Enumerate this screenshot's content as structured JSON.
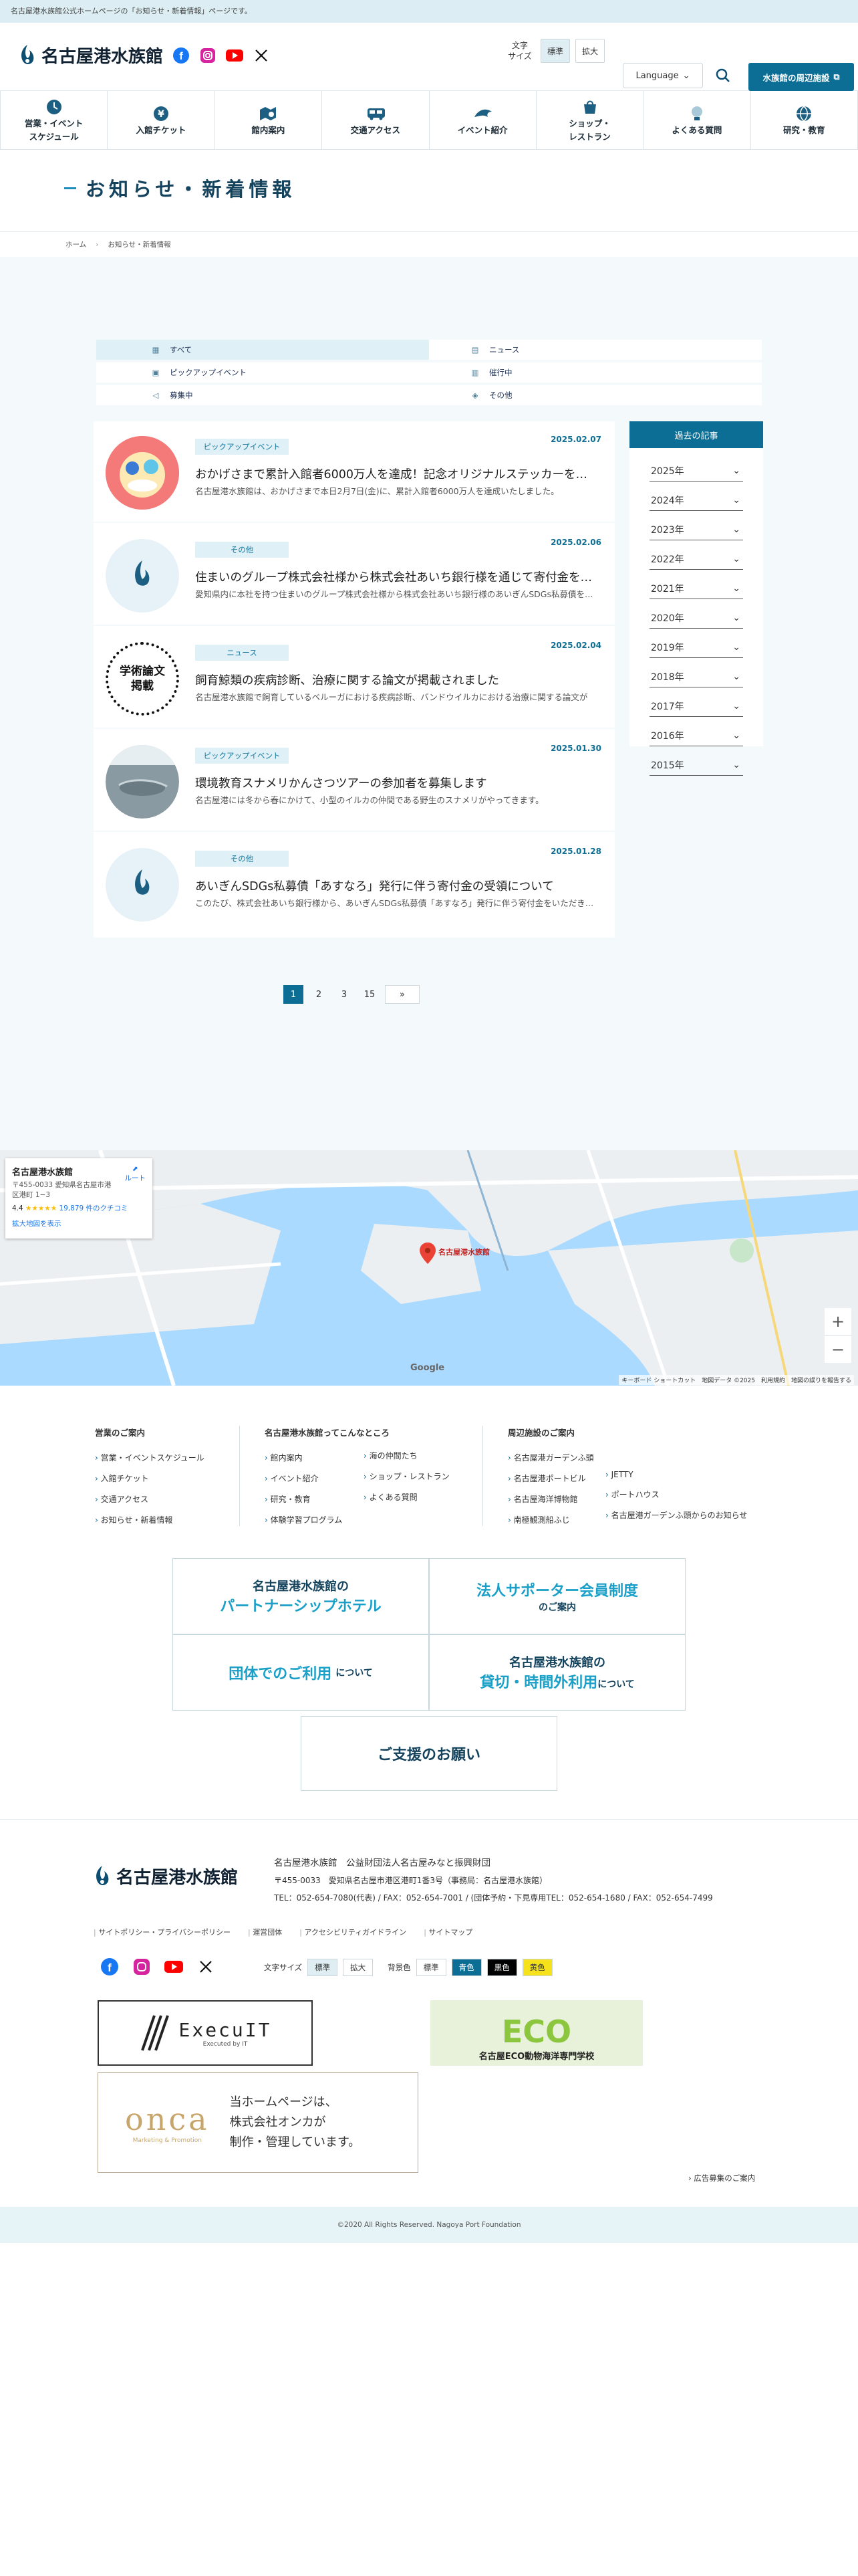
{
  "topstrip": "名古屋港水族館公式ホームページの「お知らせ・新着情報」ページです。",
  "header": {
    "logo_text": "名古屋港水族館",
    "font_size_label_1": "文字",
    "font_size_label_2": "サイズ",
    "font_standard": "標準",
    "font_large": "拡大",
    "language": "Language",
    "nearby": "水族館の周辺施設",
    "sns": [
      "facebook-icon",
      "instagram-icon",
      "youtube-icon",
      "x-icon"
    ]
  },
  "nav": [
    {
      "l1": "営業・イベント",
      "l2": "スケジュール",
      "icon": "clock-icon"
    },
    {
      "l1": "入館チケット",
      "l2": "",
      "icon": "yen-icon"
    },
    {
      "l1": "館内案内",
      "l2": "",
      "icon": "map-search-icon"
    },
    {
      "l1": "交通アクセス",
      "l2": "",
      "icon": "bus-icon"
    },
    {
      "l1": "イベント紹介",
      "l2": "",
      "icon": "dolphin-icon"
    },
    {
      "l1": "ショップ・",
      "l2": "レストラン",
      "icon": "shop-icon"
    },
    {
      "l1": "よくある質問",
      "l2": "",
      "icon": "lightbulb-icon"
    },
    {
      "l1": "研究・教育",
      "l2": "",
      "icon": "globe-icon"
    }
  ],
  "page": {
    "title": "お知らせ・新着情報"
  },
  "breadcrumb": {
    "home": "ホーム",
    "current": "お知らせ・新着情報"
  },
  "filters": {
    "all": "すべて",
    "news": "ニュース",
    "pickup": "ピックアップイベント",
    "events": "催行中",
    "recruit": "募集中",
    "other": "その他"
  },
  "posts": [
    {
      "date": "2025.02.07",
      "category": "ピックアップイベント",
      "title": "おかげさまで累計入館者6000万人を達成！記念オリジナルステッカーをプレゼント",
      "excerpt": "名古屋港水族館は、おかげさまで本日2月7日(金)に、累計入館者6000万人を達成いたしました。"
    },
    {
      "date": "2025.02.06",
      "category": "その他",
      "title": "住まいのグループ株式会社様から株式会社あいち銀行様を通じて寄付金をいただきました",
      "excerpt": "愛知県内に本社を持つ住まいのグループ株式会社様から株式会社あいち銀行様のあいぎんSDGs私募債を通じて"
    },
    {
      "date": "2025.02.04",
      "category": "ニュース",
      "title": "飼育鯨類の疾病診断、治療に関する論文が掲載されました",
      "excerpt": "名古屋港水族館で飼育しているベルーガにおける疾病診断、バンドウイルカにおける治療に関する論文が"
    },
    {
      "date": "2025.01.30",
      "category": "ピックアップイベント",
      "title": "環境教育スナメリかんさつツアーの参加者を募集します",
      "excerpt": "名古屋港には冬から春にかけて、小型のイルカの仲間である野生のスナメリがやってきます。"
    },
    {
      "date": "2025.01.28",
      "category": "その他",
      "title": "あいぎんSDGs私募債「あすなろ」発行に伴う寄付金の受領について",
      "excerpt": "このたび、株式会社あいち銀行様から、あいぎんSDGs私募債「あすなろ」発行に伴う寄付金をいただきました"
    }
  ],
  "thumb_text": {
    "paper_1": "学術論文",
    "paper_2": "掲載"
  },
  "archive": {
    "title": "過去の記事",
    "years": [
      "2025年",
      "2024年",
      "2023年",
      "2022年",
      "2021年",
      "2020年",
      "2019年",
      "2018年",
      "2017年",
      "2016年",
      "2015年"
    ]
  },
  "pagination": {
    "pages": [
      "1",
      "2",
      "3",
      "15"
    ],
    "current": "1",
    "next": "»"
  },
  "map": {
    "name": "名古屋港水族館",
    "address": "〒455-0033 愛知県名古屋市港区港町 1−3",
    "rating": "4.4",
    "stars": "★★★★★",
    "reviews": "19,879 件のクチコミ",
    "route": "ルート",
    "enlarge": "拡大地図を表示",
    "pin_label": "名古屋港水族館",
    "credit": "キーボード ショートカット　地図データ ©2025　利用規約　地図の誤りを報告する",
    "google": "Google"
  },
  "footer_links": {
    "col1_title": "営業のご案内",
    "col1": [
      "営業・イベントスケジュール",
      "入館チケット",
      "交通アクセス",
      "お知らせ・新着情報"
    ],
    "col2_title": "名古屋港水族館ってこんなところ",
    "col2a": [
      "館内案内",
      "イベント紹介",
      "研究・教育",
      "体験学習プログラム"
    ],
    "col2b": [
      "海の仲間たち",
      "ショップ・レストラン",
      "よくある質問"
    ],
    "col3_title": "周辺施設のご案内",
    "col3a": [
      "名古屋港ガーデンふ頭",
      "名古屋港ポートビル",
      "名古屋海洋博物館",
      "南極観測船ふじ"
    ],
    "col3b": [
      "JETTY",
      "ポートハウス",
      "名古屋港ガーデンふ頭からのお知らせ"
    ]
  },
  "banners": {
    "b1_a": "名古屋港水族館の",
    "b1_b": "パートナーシップホテル",
    "b2_b": "法人サポーター会員制度",
    "b2_c": "のご案内",
    "b3_b": "団体でのご利用",
    "b3_c": "について",
    "b4_a": "名古屋港水族館の",
    "b4_b": "貸切・時間外利用",
    "b4_c": "について",
    "b5": "ご支援のお願い"
  },
  "org": {
    "name": "名古屋港水族館　公益財団法人名古屋みなと振興財団",
    "address": "〒455-0033　愛知県名古屋市港区港町1番3号（事務局：名古屋港水族館）",
    "tel": "TEL：052-654-7080(代表) / FAX：052-654-7001 / (団体予約・下見専用TEL：052-654-1680 / FAX：052-654-7499",
    "links": [
      "サイトポリシー・プライバシーポリシー",
      "運営団体",
      "アクセシビリティガイドライン",
      "サイトマップ"
    ],
    "font_size": "文字サイズ",
    "standard": "標準",
    "large": "拡大",
    "bg_color": "背景色",
    "bg_std": "標準",
    "bg_blue": "青色",
    "bg_black": "黒色",
    "bg_yellow": "黄色"
  },
  "sponsors": {
    "execuit": "ExecuIT",
    "execuit_sub": "Executed by IT",
    "eco": "名古屋ECO動物海洋専門学校",
    "eco_big": "ECO",
    "onca": "onca",
    "onca_sub": "Marketing & Promotion",
    "onca_note_1": "当ホームページは、",
    "onca_note_2": "株式会社オンカが",
    "onca_note_3": "制作・管理しています。"
  },
  "ad_link": "広告募集のご案内",
  "copyright": "©2020 All Rights Reserved. Nagoya Port Foundation",
  "colors": {
    "primary": "#0d6e95",
    "accent": "#1d8fba",
    "heading": "#14435e",
    "bg_light": "#f4f9fb"
  }
}
